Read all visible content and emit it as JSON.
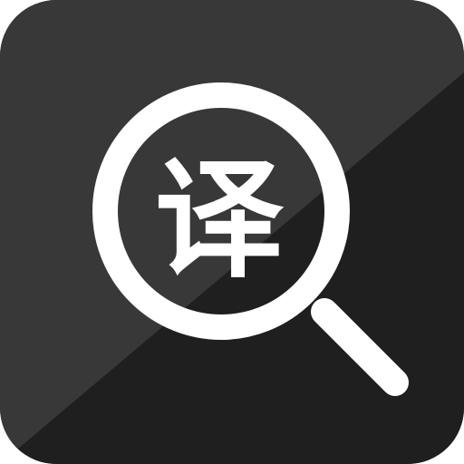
{
  "app_icon": {
    "glyph": "译",
    "icon_name": "magnifier-translate-icon",
    "colors": {
      "background_dark": "#1f1f1f",
      "background_light": "#3a3a3a",
      "foreground": "#ffffff"
    }
  }
}
